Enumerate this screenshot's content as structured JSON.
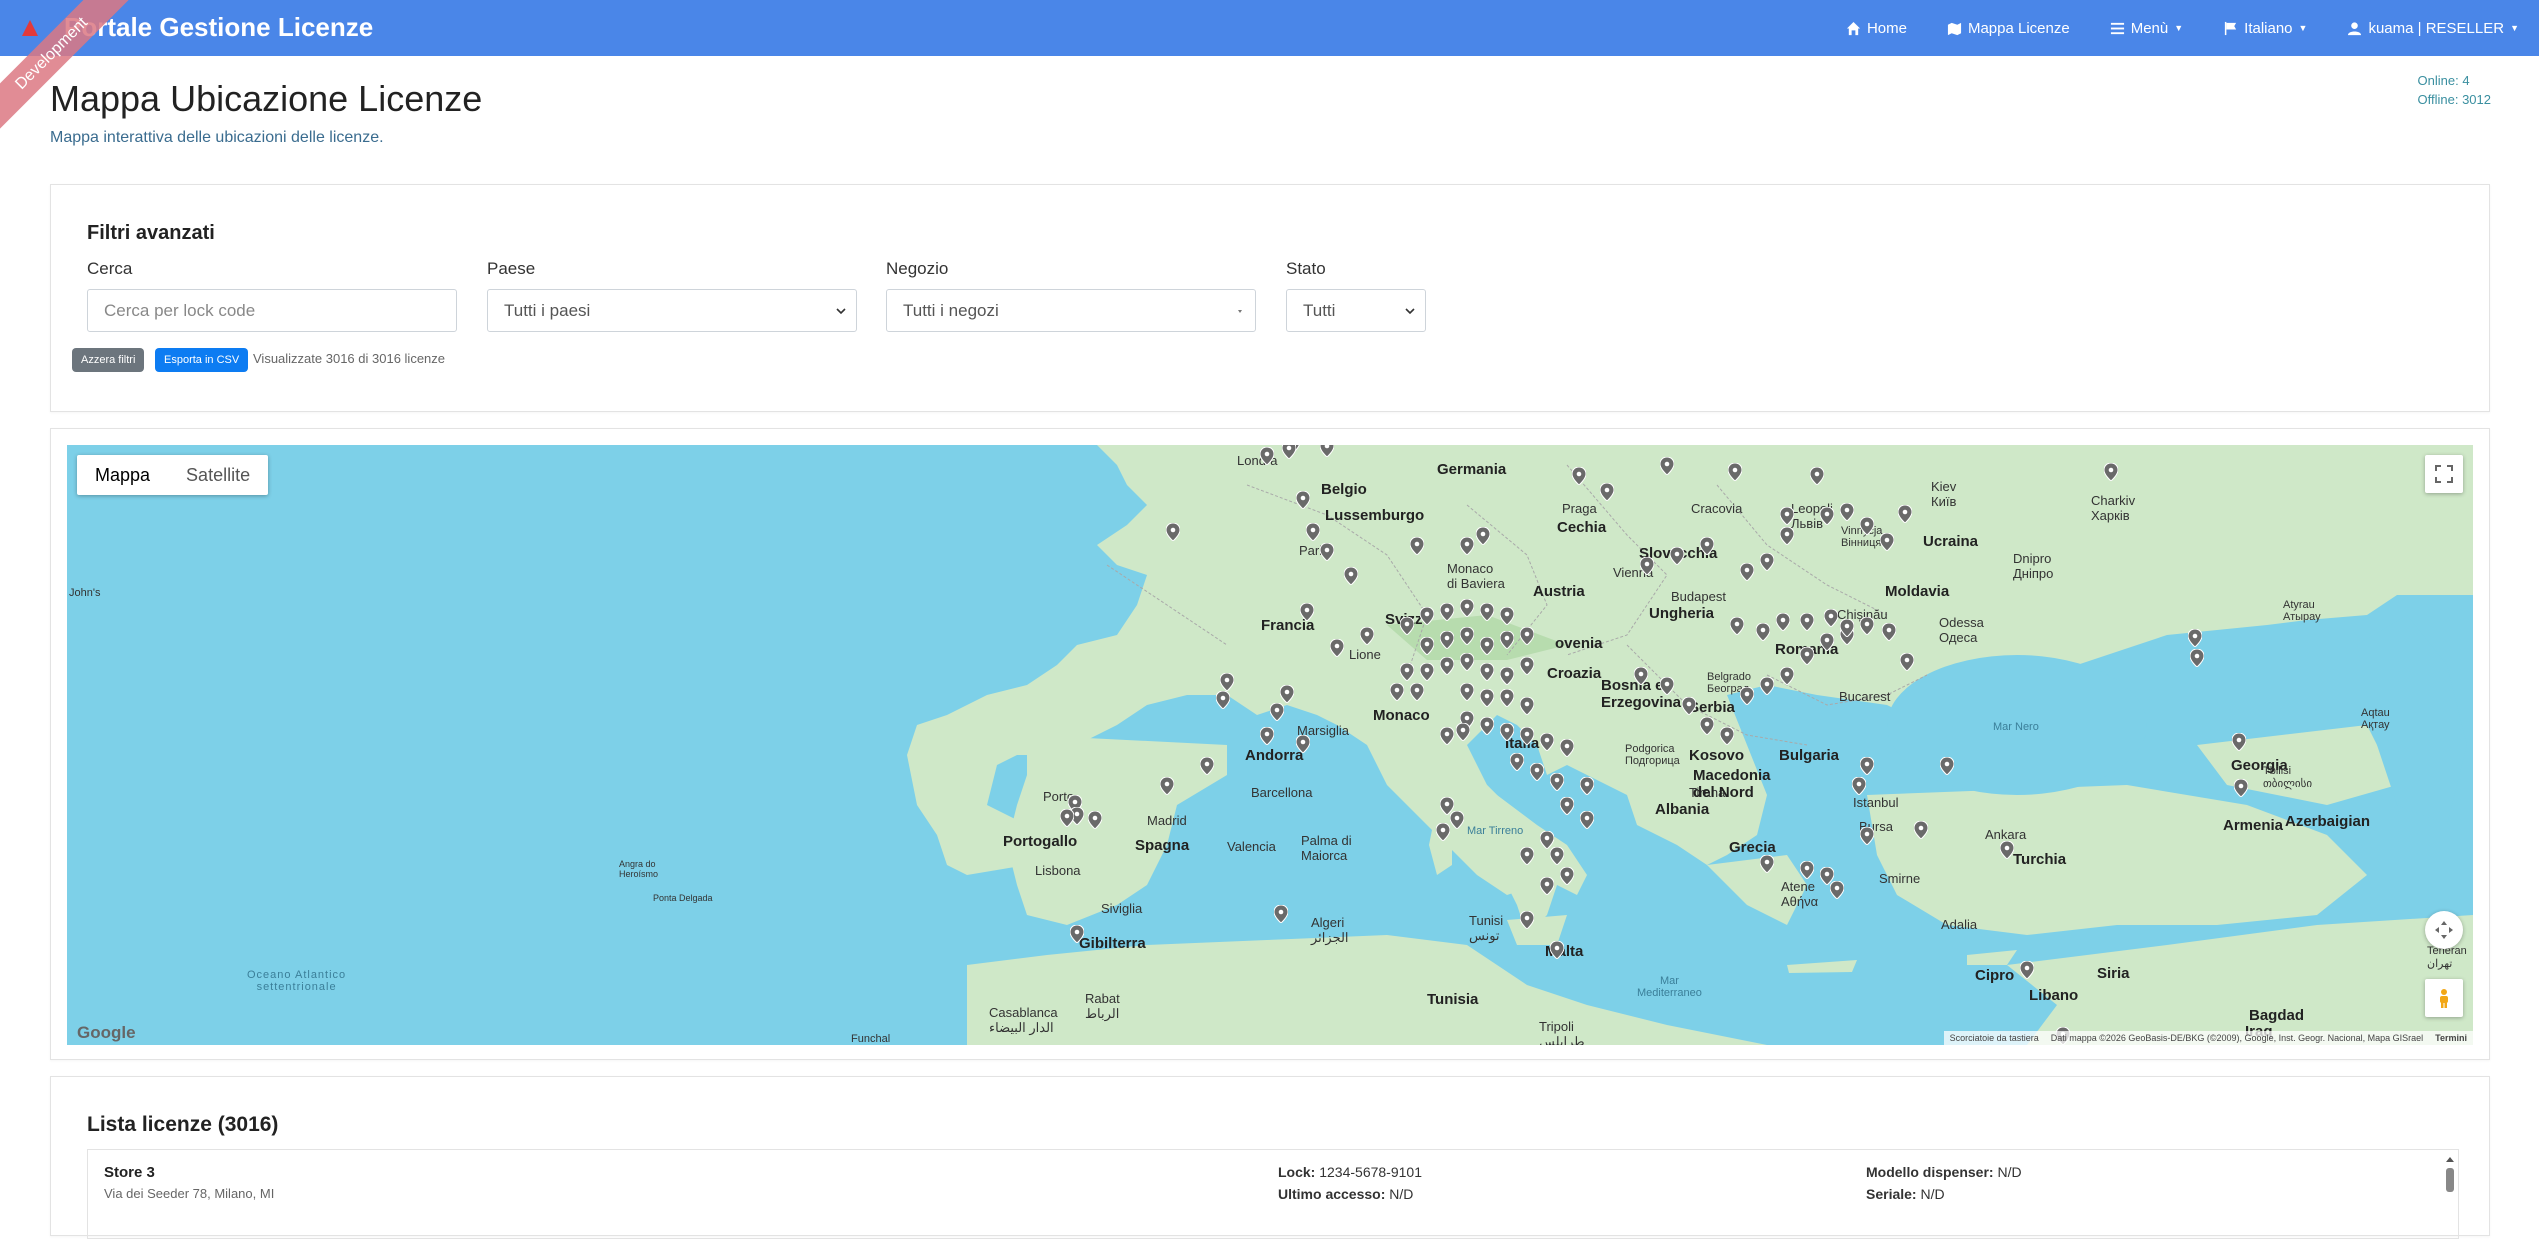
{
  "navbar": {
    "brand": "Portale Gestione Licenze",
    "ribbon": "Development",
    "items": [
      {
        "label": "Home",
        "icon": "home-icon"
      },
      {
        "label": "Mappa Licenze",
        "icon": "map-icon"
      },
      {
        "label": "Menù",
        "icon": "list-icon"
      },
      {
        "label": "Italiano",
        "icon": "flag-icon"
      },
      {
        "label": "kuama | RESELLER",
        "icon": "user-icon"
      }
    ]
  },
  "header": {
    "title": "Mappa Ubicazione Licenze",
    "subtitle": "Mappa interattiva delle ubicazioni delle licenze.",
    "online": "Online: 4",
    "offline": "Offline: 3012"
  },
  "filters": {
    "title": "Filtri avanzati",
    "search_label": "Cerca",
    "search_placeholder": "Cerca per lock code",
    "country_label": "Paese",
    "country_value": "Tutti i paesi",
    "store_label": "Negozio",
    "store_value": "Tutti i negozi",
    "state_label": "Stato",
    "state_value": "Tutti",
    "reset_button": "Azzera filtri",
    "export_button": "Esporta in CSV",
    "result_count": "Visualizzate 3016 di 3016 licenze"
  },
  "map": {
    "type_map": "Mappa",
    "type_satellite": "Satellite",
    "google": "Google",
    "attrib_shortcuts": "Scorciatoie da tastiera",
    "attrib_data": "Dati mappa ©2026 GeoBasis-DE/BKG (©2009), Google, Inst. Geogr. Nacional, Mapa GISrael",
    "attrib_terms": "Termini",
    "labels": {
      "londra": "Londra",
      "belgio": "Belgio",
      "germania": "Germania",
      "lussemburgo": "Lussemburgo",
      "parigi": "Parigi",
      "praga": "Praga",
      "cechia": "Cechia",
      "cracovia": "Cracovia",
      "leopoli": "Leopoli\nЛьвів",
      "kiev": "Kiev\nКиїв",
      "charkiv": "Charkiv\nХарків",
      "ucraina": "Ucraina",
      "monaco_baviera": "Monaco\ndi Baviera",
      "slovacchia": "Slovacchia",
      "vienna": "Vienna",
      "austria": "Austria",
      "dnipro": "Dnipro\nДніпро",
      "vinnycja": "Vinnycja\nВінниця",
      "budapest": "Budapest",
      "moldavia": "Moldavia",
      "chisinau": "Chișinău",
      "ungheria": "Ungheria",
      "francia": "Francia",
      "svizzera": "Svizz",
      "lione": "Lione",
      "slovenia": "ovenia",
      "croazia": "Croazia",
      "romania": "Romania",
      "odessa": "Odessa\nОдеса",
      "atyrau": "Atyrau\nАтырау",
      "bosnia": "Bosnia ed\nErzegovina",
      "serbia": "Serbia",
      "belgrado": "Belgrado\nБеоград",
      "bucarest": "Bucarest",
      "monaco": "Monaco",
      "marsiglia": "Marsiglia",
      "italia": "Italia",
      "mar_nero": "Mar Nero",
      "aqtau": "Aqtau\nАқтау",
      "andorra": "Andorra",
      "podgorica": "Podgorica\nПодгорица",
      "kosovo": "Kosovo",
      "bulgaria": "Bulgaria",
      "georgia": "Georgia",
      "tbilisi": "Tbilisi\nთბილისი",
      "porto": "Porto",
      "barcellona": "Barcellona",
      "tirana": "Tirana",
      "macedonia": "Macedonia\ndel Nord",
      "albania": "Albania",
      "istanbul": "Istanbul",
      "madrid": "Madrid",
      "bursa": "Bursa",
      "ankara": "Ankara",
      "armenia": "Armenia",
      "azerbaigian": "Azerbaigian",
      "portogallo": "Portogallo",
      "spagna": "Spagna",
      "valencia": "Valencia",
      "palma": "Palma di\nMaiorca",
      "mar_tirreno": "Mar Tirreno",
      "grecia": "Grecia",
      "turchia": "Turchia",
      "lisbona": "Lisbona",
      "angra": "Angra do\nHeroísmo",
      "ponta": "Ponta Delgada",
      "atene": "Atene\nΑθήνα",
      "smirne": "Smirne",
      "siviglia": "Siviglia",
      "algeri": "Algeri\nالجزائر",
      "tunisi": "Tunisi\nتونس",
      "gibilterra": "Gibilterra",
      "adalia": "Adalia",
      "malta": "Malta",
      "oceano": "Oceano Atlantico\nsettentrionale",
      "cipro": "Cipro",
      "siria": "Siria",
      "mar_med": "Mar\nMediterraneo",
      "libano": "Libano",
      "teheran": "Teheran\nتهران",
      "rabat": "Rabat\nالرباط",
      "casablanca": "Casablanca\nالدار البيضاء",
      "tunisia": "Tunisia",
      "bagdad": "Bagdad",
      "iraq": "Iraq",
      "tripoli": "Tripoli\nطرابلس",
      "funchal": "Funchal",
      "johns": "John's"
    }
  },
  "list": {
    "title": "Lista licenze (3016)",
    "rows": [
      {
        "store": "Store 3",
        "address": "Via dei Seeder 78, Milano, MI",
        "lock_label": "Lock:",
        "lock_value": "1234-5678-9101",
        "access_label": "Ultimo accesso:",
        "access_value": "N/D",
        "model_label": "Modello dispenser:",
        "model_value": "N/D",
        "serial_label": "Seriale:",
        "serial_value": "N/D"
      }
    ]
  },
  "colors": {
    "navbar": "#4a86e8",
    "sea": "#7dd0e8",
    "land": "#cfe8c8",
    "pin": "#6a6a6a",
    "export": "#0d7cf2",
    "reset": "#6c757d"
  }
}
